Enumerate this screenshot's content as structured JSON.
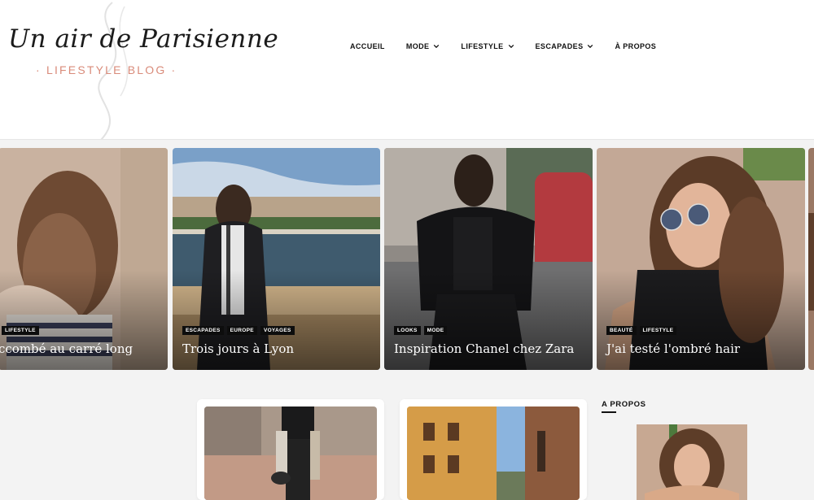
{
  "logo": {
    "title": "Un air de Parisienne",
    "subtitle": "· LIFESTYLE BLOG ·"
  },
  "nav": {
    "items": [
      {
        "label": "ACCUEIL",
        "dropdown": false
      },
      {
        "label": "MODE",
        "dropdown": true
      },
      {
        "label": "LIFESTYLE",
        "dropdown": true
      },
      {
        "label": "ESCAPADES",
        "dropdown": true
      },
      {
        "label": "À PROPOS",
        "dropdown": false
      }
    ]
  },
  "slider": {
    "slides": [
      {
        "title": "ccombé au carré long",
        "tags": [
          "LIFESTYLE"
        ]
      },
      {
        "title": "Trois jours à Lyon",
        "tags": [
          "ESCAPADES",
          "EUROPE",
          "VOYAGES"
        ]
      },
      {
        "title": "Inspiration Chanel chez Zara",
        "tags": [
          "LOOKS",
          "MODE"
        ]
      },
      {
        "title": "J'ai testé l'ombré hair",
        "tags": [
          "BEAUTÉ",
          "LIFESTYLE"
        ]
      }
    ]
  },
  "sidebar": {
    "about_title": "A PROPOS"
  },
  "colors": {
    "accent": "#d98b7a",
    "text": "#111111",
    "tag_bg": "#0d0d0d",
    "page_bg": "#f3f3f3"
  }
}
